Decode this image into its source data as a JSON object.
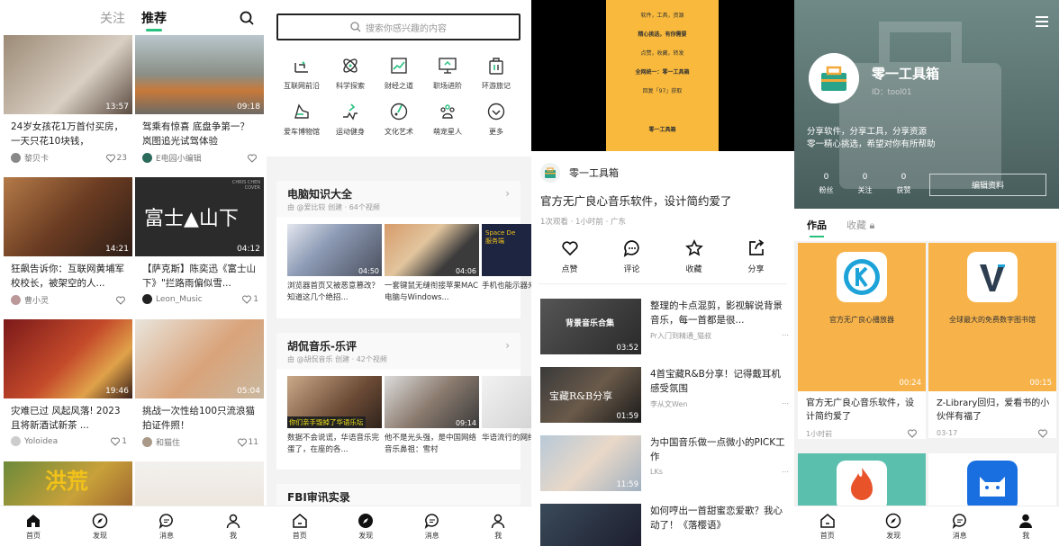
{
  "nav": {
    "home": "首页",
    "discover": "发现",
    "messages": "消息",
    "me": "我"
  },
  "p1": {
    "tabs": [
      "关注",
      "推荐"
    ],
    "cards": [
      {
        "title": "24岁女孩花1万首付买房，一天只花10块钱，",
        "author": "黎贝卡",
        "likes": "23",
        "dur": "13:57"
      },
      {
        "title": "驾乘有惊喜 底盘争第一？ 岚图追光试驾体验",
        "author": "E电园小编辑",
        "likes": "",
        "dur": "09:18"
      },
      {
        "title": "狂飙告诉你：互联网黄埔军校校长，被架空的人...",
        "author": "曹小灵",
        "likes": "",
        "dur": "14:21"
      },
      {
        "title": "【萨克斯】陈奕迅《富士山下》\"拦路雨偏似雪...",
        "author": "Leon_Music",
        "likes": "1",
        "dur": "04:12",
        "cover": "富士▲山下",
        "cover_tag": "CHRIS CHEN COVER"
      },
      {
        "title": "灾难已过 风起风落! 2023 且将新酒试新茶 ...",
        "author": "Yoloidea",
        "likes": "1",
        "dur": "19:46"
      },
      {
        "title": "挑战一次性给100只流浪猫拍证件照！",
        "author": "和猫住",
        "likes": "11",
        "dur": "05:04"
      },
      {
        "title": "",
        "author": "",
        "likes": "",
        "dur": "",
        "cover": "洪荒"
      },
      {
        "title": "",
        "author": "",
        "likes": "",
        "dur": ""
      }
    ]
  },
  "p2": {
    "search_placeholder": "搜索你感兴趣的内容",
    "cats": [
      "互联网前沿",
      "科学探索",
      "财经之道",
      "职场进阶",
      "环游旅记",
      "爱车博物馆",
      "运动健身",
      "文化艺术",
      "萌宠星人",
      "更多"
    ],
    "collections": [
      {
        "title": "电脑知识大全",
        "sub": "由 @爱比较 创建 · 64个视频",
        "videos": [
          {
            "t": "浏览器首页又被恶意篡改？知道这几个绝招...",
            "dur": "04:50"
          },
          {
            "t": "一套键鼠无缝衔接苹果MAC电脑与Windows...",
            "dur": "04:06"
          },
          {
            "t": "手机也能示器来使",
            "dur": "",
            "cover": "Space De 服务端"
          }
        ]
      },
      {
        "title": "胡侃音乐-乐评",
        "sub": "由 @胡侃音乐 创建 · 42个视频",
        "videos": [
          {
            "t": "数据不会说谎，华语音乐完蛋了，在座的各...",
            "dur": "",
            "cover": "你们亲手毁掉了华语乐坛"
          },
          {
            "t": "他不是光头强，是中国网络音乐鼻祖：雪村",
            "dur": "09:14"
          },
          {
            "t": "华语流行的网络神",
            "dur": ""
          }
        ]
      },
      {
        "title": "FBI审讯实录",
        "sub": "",
        "videos": []
      }
    ]
  },
  "p3": {
    "poster_lines": [
      "软件，工具，资源",
      "精心挑选，有你需要",
      "点赞，收藏，转发",
      "全网统一：零一工具箱",
      "回复「97」获取",
      "零一工具箱"
    ],
    "channel": "零一工具箱",
    "title": "官方无广良心音乐软件，设计简约爱了",
    "meta": "1次观看 · 1小时前 · 广东",
    "actions": [
      "点赞",
      "评论",
      "收藏",
      "分享"
    ],
    "recs": [
      {
        "t": "整理的卡点混剪，影视解说背景音乐，每一首都是很...",
        "a": "Pr入门到精通_猫叔",
        "dur": "03:52",
        "cover": "背景音乐合集"
      },
      {
        "t": "4首宝藏R&B分享！记得戴耳机感受氛围",
        "a": "李从文Wen",
        "dur": "01:59",
        "cover": "宝藏R&B分享"
      },
      {
        "t": "为中国音乐做一点微小的PICK工作",
        "a": "LKs",
        "dur": "11:59"
      },
      {
        "t": "如何哼出一首甜蜜恋爱歌？我心动了！《落樱语》",
        "a": "",
        "dur": ""
      }
    ]
  },
  "p4": {
    "name": "零一工具箱",
    "id": "ID：tool01",
    "bio": [
      "分享软件，分享工具，分享资源",
      "零一精心挑选，希望对你有所帮助"
    ],
    "stats": [
      {
        "n": "0",
        "l": "粉丝"
      },
      {
        "n": "0",
        "l": "关注"
      },
      {
        "n": "0",
        "l": "获赞"
      }
    ],
    "edit": "编辑资料",
    "tabs": [
      "作品",
      "收藏"
    ],
    "works": [
      {
        "t": "官方无广良心音乐软件，设计简约爱了",
        "m": "1小时前",
        "lab": "官方无广良心播放器",
        "dur": "00:24"
      },
      {
        "t": "Z-Library回归，爱看书的小伙伴有福了",
        "m": "03-17",
        "lab": "全球最大的免费数字图书馆",
        "dur": "00:15"
      }
    ]
  }
}
